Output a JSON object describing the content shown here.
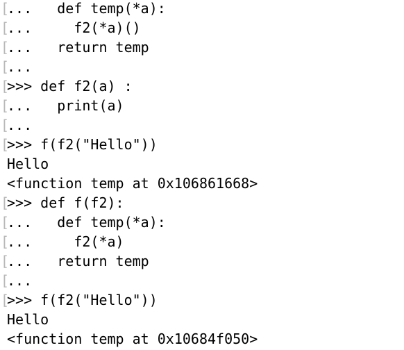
{
  "terminal": {
    "marker": "[",
    "lines": [
      {
        "marked": true,
        "text": "...   def temp(*a):"
      },
      {
        "marked": true,
        "text": "...     f2(*a)()"
      },
      {
        "marked": true,
        "text": "...   return temp"
      },
      {
        "marked": true,
        "text": "..."
      },
      {
        "marked": true,
        "text": ">>> def f2(a) :"
      },
      {
        "marked": true,
        "text": "...   print(a)"
      },
      {
        "marked": true,
        "text": "..."
      },
      {
        "marked": true,
        "text": ">>> f(f2(\"Hello\"))"
      },
      {
        "marked": false,
        "text": "Hello"
      },
      {
        "marked": false,
        "text": "<function temp at 0x106861668>"
      },
      {
        "marked": true,
        "text": ">>> def f(f2):"
      },
      {
        "marked": true,
        "text": "...   def temp(*a):"
      },
      {
        "marked": true,
        "text": "...     f2(*a)"
      },
      {
        "marked": true,
        "text": "...   return temp"
      },
      {
        "marked": true,
        "text": "..."
      },
      {
        "marked": true,
        "text": ">>> f(f2(\"Hello\"))"
      },
      {
        "marked": false,
        "text": "Hello"
      },
      {
        "marked": false,
        "text": "<function temp at 0x10684f050>"
      }
    ]
  }
}
